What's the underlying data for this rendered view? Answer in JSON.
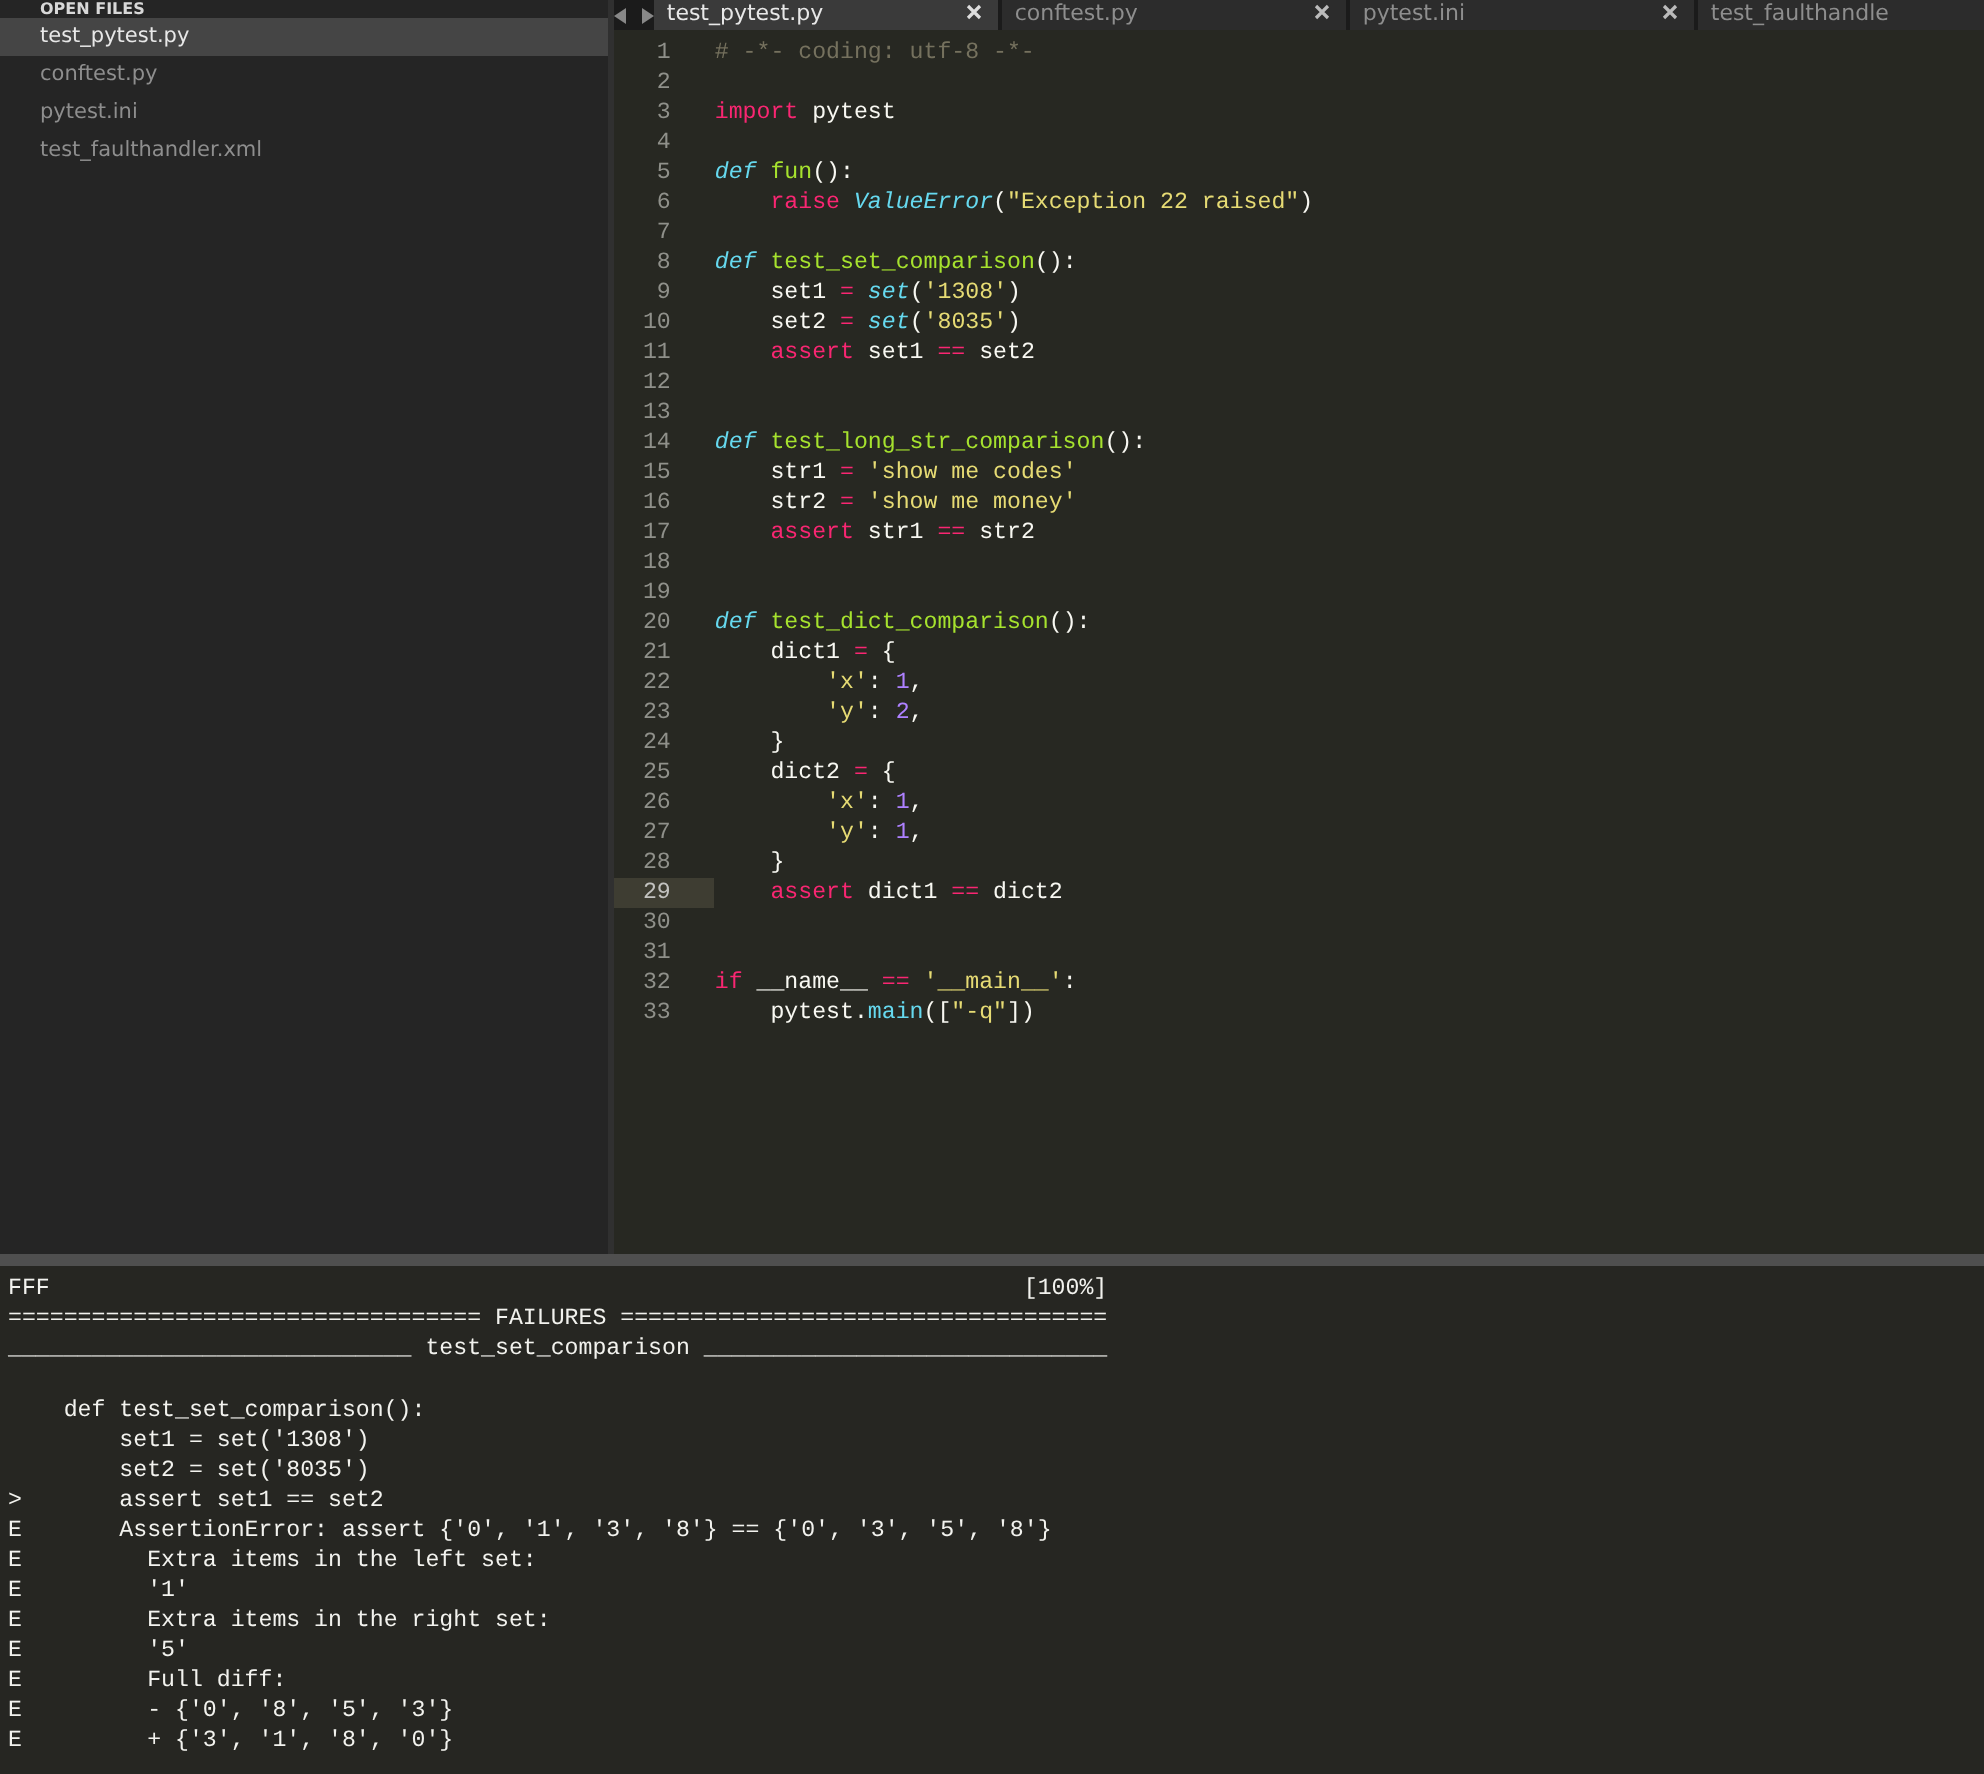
{
  "sidebar": {
    "header": "OPEN FILES",
    "items": [
      {
        "label": "test_pytest.py",
        "selected": true
      },
      {
        "label": "conftest.py",
        "selected": false
      },
      {
        "label": "pytest.ini",
        "selected": false
      },
      {
        "label": "test_faulthandler.xml",
        "selected": false
      }
    ]
  },
  "tabs": [
    {
      "label": "test_pytest.py",
      "selected": true
    },
    {
      "label": "conftest.py",
      "selected": false
    },
    {
      "label": "pytest.ini",
      "selected": false
    },
    {
      "label": "test_faulthandle",
      "selected": false
    }
  ],
  "code": {
    "lines": [
      {
        "number": "1",
        "current": false,
        "tokens": [
          {
            "kind": "comment",
            "text": "# -*- coding: utf-8 -*-"
          }
        ]
      },
      {
        "number": "2",
        "current": false
      },
      {
        "number": "3",
        "current": false,
        "tokens": [
          {
            "kind": "keyword",
            "text": "import"
          },
          {
            "kind": "text",
            "text": " pytest"
          }
        ]
      },
      {
        "number": "4",
        "current": false
      },
      {
        "number": "5",
        "current": false,
        "tokens": [
          {
            "kind": "storage",
            "text": "def"
          },
          {
            "kind": "name",
            "text": " fun"
          },
          {
            "kind": "text",
            "text": "():"
          }
        ]
      },
      {
        "number": "6",
        "current": false,
        "tokens": [
          {
            "kind": "keyword",
            "text": "    raise"
          },
          {
            "kind": "builtin",
            "text": " ValueError"
          },
          {
            "kind": "text",
            "text": "("
          },
          {
            "kind": "string",
            "text": "\"Exception 22 raised\""
          },
          {
            "kind": "text",
            "text": ")"
          }
        ]
      },
      {
        "number": "7",
        "current": false
      },
      {
        "number": "8",
        "current": false,
        "tokens": [
          {
            "kind": "storage",
            "text": "def"
          },
          {
            "kind": "name",
            "text": " test_set_comparison"
          },
          {
            "kind": "text",
            "text": "():"
          }
        ]
      },
      {
        "number": "9",
        "current": false,
        "tokens": [
          {
            "kind": "text",
            "text": "    set1 "
          },
          {
            "kind": "operator",
            "text": "="
          },
          {
            "kind": "builtin",
            "text": " set"
          },
          {
            "kind": "text",
            "text": "("
          },
          {
            "kind": "string",
            "text": "'1308'"
          },
          {
            "kind": "text",
            "text": ")"
          }
        ]
      },
      {
        "number": "10",
        "current": false,
        "tokens": [
          {
            "kind": "text",
            "text": "    set2 "
          },
          {
            "kind": "operator",
            "text": "="
          },
          {
            "kind": "builtin",
            "text": " set"
          },
          {
            "kind": "text",
            "text": "("
          },
          {
            "kind": "string",
            "text": "'8035'"
          },
          {
            "kind": "text",
            "text": ")"
          }
        ]
      },
      {
        "number": "11",
        "current": false,
        "tokens": [
          {
            "kind": "keyword",
            "text": "    assert"
          },
          {
            "kind": "text",
            "text": " set1 "
          },
          {
            "kind": "operator",
            "text": "=="
          },
          {
            "kind": "text",
            "text": " set2"
          }
        ]
      },
      {
        "number": "12",
        "current": false
      },
      {
        "number": "13",
        "current": false
      },
      {
        "number": "14",
        "current": false,
        "tokens": [
          {
            "kind": "storage",
            "text": "def"
          },
          {
            "kind": "name",
            "text": " test_long_str_comparison"
          },
          {
            "kind": "text",
            "text": "():"
          }
        ]
      },
      {
        "number": "15",
        "current": false,
        "tokens": [
          {
            "kind": "text",
            "text": "    str1 "
          },
          {
            "kind": "operator",
            "text": "="
          },
          {
            "kind": "string",
            "text": " 'show me codes'"
          }
        ]
      },
      {
        "number": "16",
        "current": false,
        "tokens": [
          {
            "kind": "text",
            "text": "    str2 "
          },
          {
            "kind": "operator",
            "text": "="
          },
          {
            "kind": "string",
            "text": " 'show me money'"
          }
        ]
      },
      {
        "number": "17",
        "current": false,
        "tokens": [
          {
            "kind": "keyword",
            "text": "    assert"
          },
          {
            "kind": "text",
            "text": " str1 "
          },
          {
            "kind": "operator",
            "text": "=="
          },
          {
            "kind": "text",
            "text": " str2"
          }
        ]
      },
      {
        "number": "18",
        "current": false
      },
      {
        "number": "19",
        "current": false
      },
      {
        "number": "20",
        "current": false,
        "tokens": [
          {
            "kind": "storage",
            "text": "def"
          },
          {
            "kind": "name",
            "text": " test_dict_comparison"
          },
          {
            "kind": "text",
            "text": "():"
          }
        ]
      },
      {
        "number": "21",
        "current": false,
        "tokens": [
          {
            "kind": "text",
            "text": "    dict1 "
          },
          {
            "kind": "operator",
            "text": "="
          },
          {
            "kind": "text",
            "text": " {"
          }
        ]
      },
      {
        "number": "22",
        "current": false,
        "tokens": [
          {
            "kind": "string",
            "text": "        'x'"
          },
          {
            "kind": "text",
            "text": ": "
          },
          {
            "kind": "number",
            "text": "1"
          },
          {
            "kind": "text",
            "text": ","
          }
        ]
      },
      {
        "number": "23",
        "current": false,
        "tokens": [
          {
            "kind": "string",
            "text": "        'y'"
          },
          {
            "kind": "text",
            "text": ": "
          },
          {
            "kind": "number",
            "text": "2"
          },
          {
            "kind": "text",
            "text": ","
          }
        ]
      },
      {
        "number": "24",
        "current": false,
        "tokens": [
          {
            "kind": "text",
            "text": "    }"
          }
        ]
      },
      {
        "number": "25",
        "current": false,
        "tokens": [
          {
            "kind": "text",
            "text": "    dict2 "
          },
          {
            "kind": "operator",
            "text": "="
          },
          {
            "kind": "text",
            "text": " {"
          }
        ]
      },
      {
        "number": "26",
        "current": false,
        "tokens": [
          {
            "kind": "string",
            "text": "        'x'"
          },
          {
            "kind": "text",
            "text": ": "
          },
          {
            "kind": "number",
            "text": "1"
          },
          {
            "kind": "text",
            "text": ","
          }
        ]
      },
      {
        "number": "27",
        "current": false,
        "tokens": [
          {
            "kind": "string",
            "text": "        'y'"
          },
          {
            "kind": "text",
            "text": ": "
          },
          {
            "kind": "number",
            "text": "1"
          },
          {
            "kind": "text",
            "text": ","
          }
        ]
      },
      {
        "number": "28",
        "current": false,
        "tokens": [
          {
            "kind": "text",
            "text": "    }"
          }
        ]
      },
      {
        "number": "29",
        "current": true,
        "tokens": [
          {
            "kind": "keyword",
            "text": "    assert"
          },
          {
            "kind": "text",
            "text": " dict1 "
          },
          {
            "kind": "operator",
            "text": "=="
          },
          {
            "kind": "text",
            "text": " dict2"
          }
        ]
      },
      {
        "number": "30",
        "current": false
      },
      {
        "number": "31",
        "current": false
      },
      {
        "number": "32",
        "current": false,
        "tokens": [
          {
            "kind": "keyword",
            "text": "if"
          },
          {
            "kind": "text",
            "text": " __name__ "
          },
          {
            "kind": "operator",
            "text": "=="
          },
          {
            "kind": "string",
            "text": " '__main__'"
          },
          {
            "kind": "text",
            "text": ":"
          }
        ]
      },
      {
        "number": "33",
        "current": false,
        "tokens": [
          {
            "kind": "text",
            "text": "    pytest."
          },
          {
            "kind": "support",
            "text": "main"
          },
          {
            "kind": "text",
            "text": "(["
          },
          {
            "kind": "string",
            "text": "\"-q\""
          },
          {
            "kind": "text",
            "text": "])"
          }
        ]
      }
    ]
  },
  "output": {
    "progress": "FFF",
    "percent": "[100%]",
    "header_rule": "================================== FAILURES ===================================",
    "section_rule": "_____________________________ test_set_comparison _____________________________",
    "lines": [
      "    def test_set_comparison():",
      "        set1 = set('1308')",
      "        set2 = set('8035')",
      ">       assert set1 == set2",
      "E       AssertionError: assert {'0', '1', '3', '8'} == {'0', '3', '5', '8'}",
      "E         Extra items in the left set:",
      "E         '1'",
      "E         Extra items in the right set:",
      "E         '5'",
      "E         Full diff:",
      "E         - {'0', '8', '5', '3'}",
      "E         + {'3', '1', '8', '0'}"
    ]
  }
}
